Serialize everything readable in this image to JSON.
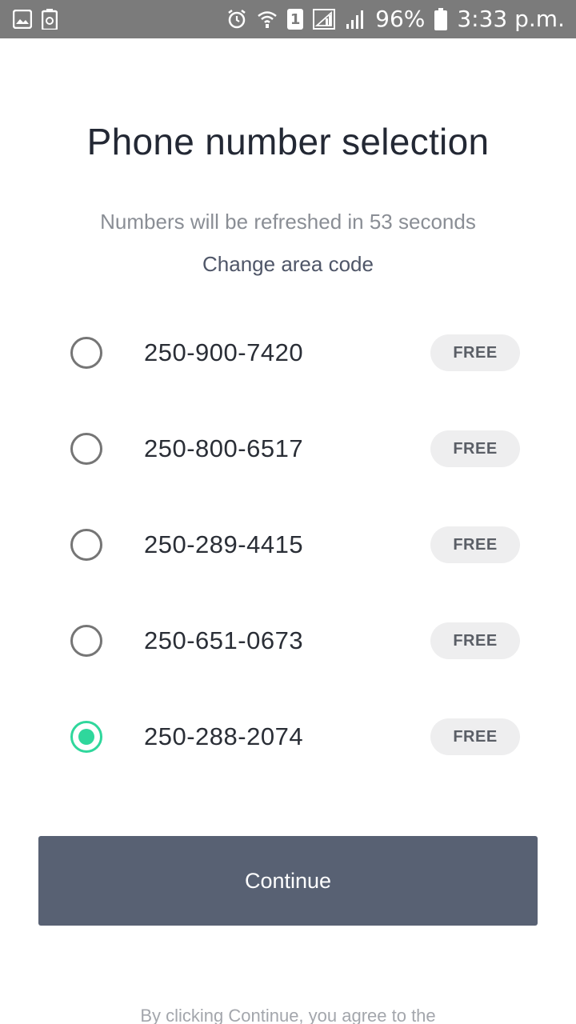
{
  "status_bar": {
    "left_icons": [
      "gallery-icon",
      "battery-saver-icon"
    ],
    "right_icons": [
      "alarm-icon",
      "wifi-icon",
      "sim-icon",
      "signal-box-icon",
      "signal-icon",
      "battery-icon"
    ],
    "sim_slot": "1",
    "battery_percent": "96%",
    "time": "3:33 p.m."
  },
  "header": {
    "title": "Phone number selection",
    "refresh_notice": "Numbers will be refreshed in 53 seconds",
    "change_area_code": "Change area code"
  },
  "numbers": [
    {
      "number": "250-900-7420",
      "price": "FREE",
      "selected": false
    },
    {
      "number": "250-800-6517",
      "price": "FREE",
      "selected": false
    },
    {
      "number": "250-289-4415",
      "price": "FREE",
      "selected": false
    },
    {
      "number": "250-651-0673",
      "price": "FREE",
      "selected": false
    },
    {
      "number": "250-288-2074",
      "price": "FREE",
      "selected": true
    }
  ],
  "actions": {
    "continue_label": "Continue"
  },
  "footer": {
    "terms_text": "By clicking Continue, you agree to the"
  },
  "colors": {
    "accent": "#2fd79c",
    "button": "#586173",
    "status_bar": "#7b7b7b"
  }
}
